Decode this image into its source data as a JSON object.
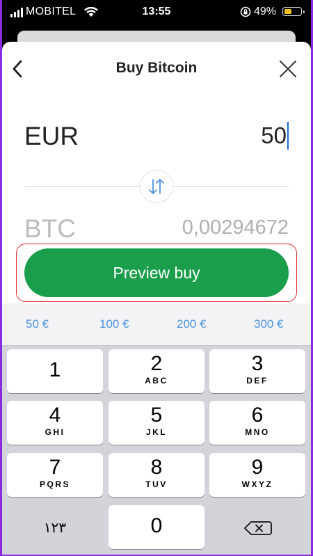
{
  "status_bar": {
    "carrier": "MOBITEL",
    "time": "13:55",
    "battery_percent": "49%",
    "battery_level": 0.49
  },
  "header": {
    "title": "Buy Bitcoin",
    "back_icon": "chevron-left-icon",
    "close_icon": "close-icon"
  },
  "fiat": {
    "code": "EUR",
    "amount": "50"
  },
  "crypto": {
    "code": "BTC",
    "amount": "0,00294672"
  },
  "swap_icon": "swap-arrows-icon",
  "preview_button": {
    "label": "Preview buy",
    "color": "#1a9e4b"
  },
  "quick_amounts": [
    "50 €",
    "100 €",
    "200 €",
    "300 €"
  ],
  "keypad": {
    "keys": [
      {
        "num": "1",
        "letters": ""
      },
      {
        "num": "2",
        "letters": "ABC"
      },
      {
        "num": "3",
        "letters": "DEF"
      },
      {
        "num": "4",
        "letters": "GHI"
      },
      {
        "num": "5",
        "letters": "JKL"
      },
      {
        "num": "6",
        "letters": "MNO"
      },
      {
        "num": "7",
        "letters": "PQRS"
      },
      {
        "num": "8",
        "letters": "TUV"
      },
      {
        "num": "9",
        "letters": "WXYZ"
      }
    ],
    "switch_label": "١٢٣",
    "zero": "0",
    "delete_icon": "backspace-icon"
  },
  "colors": {
    "accent_blue": "#4b93e0",
    "highlight_red": "#e0282f",
    "frame": "#8a2be2"
  }
}
